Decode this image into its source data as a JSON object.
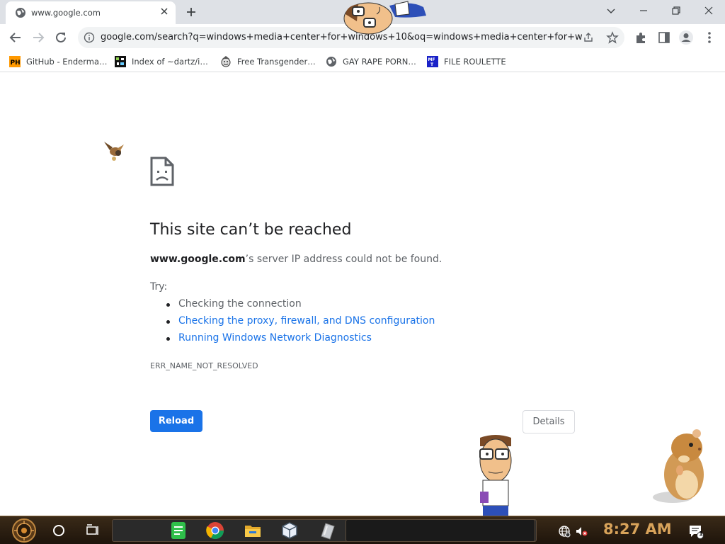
{
  "browser": {
    "tab": {
      "title": "www.google.com"
    },
    "omnibox": {
      "url": "google.com/search?q=windows+media+center+for+windows+10&oq=windows+media+center+for+window…"
    },
    "bookmarks": [
      {
        "label": "GitHub - Enderma…",
        "icon": "ph-icon"
      },
      {
        "label": "Index of ~dartz/i…",
        "icon": "pixel-icon"
      },
      {
        "label": "Free Transgender…",
        "icon": "clown-icon"
      },
      {
        "label": "GAY RAPE PORN…",
        "icon": "globe-icon"
      },
      {
        "label": "FILE ROULETTE",
        "icon": "mft-icon"
      }
    ]
  },
  "error_page": {
    "title": "This site can’t be reached",
    "host": "www.google.com",
    "description_rest": "’s server IP address could not be found.",
    "try_label": "Try:",
    "suggestions": [
      {
        "text": "Checking the connection",
        "link": false
      },
      {
        "text": "Checking the proxy, firewall, and DNS configuration",
        "link": true
      },
      {
        "text": "Running Windows Network Diagnostics",
        "link": true
      }
    ],
    "error_code": "ERR_NAME_NOT_RESOLVED",
    "reload_label": "Reload",
    "details_label": "Details"
  },
  "taskbar": {
    "clock": "8:27 AM",
    "apps": [
      "sheets-icon",
      "chrome-icon",
      "file-explorer-icon",
      "virtualbox-icon",
      "paper-icon"
    ],
    "tray": [
      "network-globe-icon",
      "volume-muted-icon"
    ],
    "notification_count": "1"
  },
  "colors": {
    "link": "#1a73e8",
    "primary_button": "#1a73e8",
    "clock": "#d8a35a",
    "tabstrip": "#dee1e6"
  }
}
